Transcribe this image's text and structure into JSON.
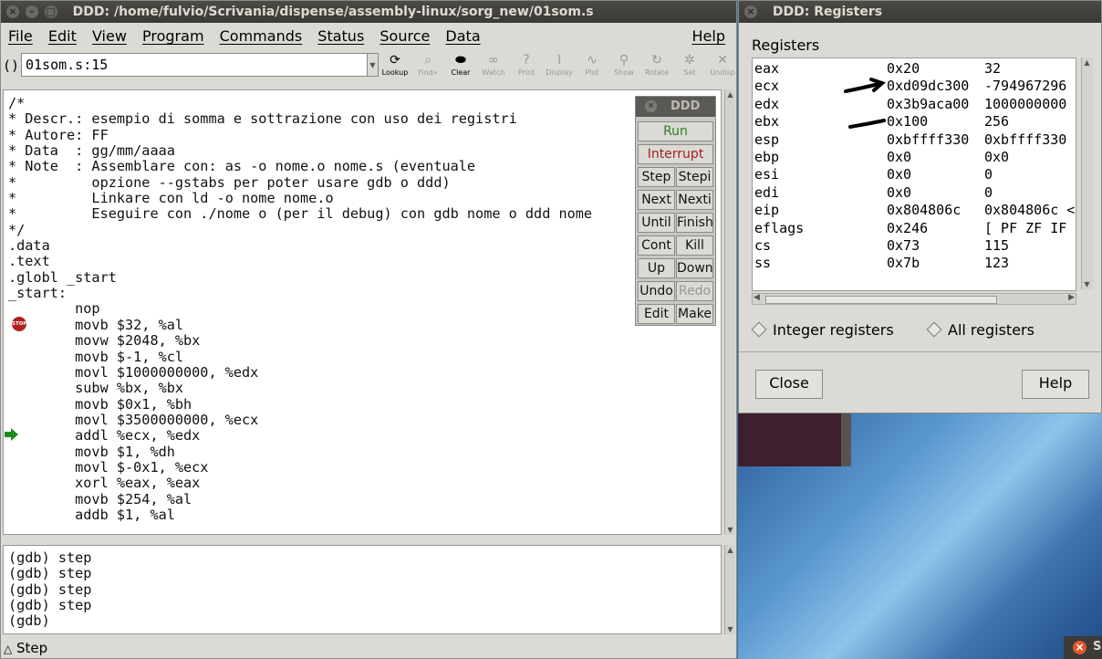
{
  "main_window": {
    "title": "DDD: /home/fulvio/Scrivania/dispense/assembly-linux/sorg_new/01som.s",
    "menu": [
      "File",
      "Edit",
      "View",
      "Program",
      "Commands",
      "Status",
      "Source",
      "Data"
    ],
    "help": "Help",
    "arg_label": "():",
    "arg_value": "01som.s:15",
    "tools": [
      {
        "label": "Lookup",
        "icon": "lookup-icon",
        "active": true
      },
      {
        "label": "Find»",
        "icon": "find-icon",
        "active": false
      },
      {
        "label": "Clear",
        "icon": "clear-icon",
        "active": true
      },
      {
        "label": "Watch",
        "icon": "watch-icon",
        "active": false
      },
      {
        "label": "Print",
        "icon": "print-icon",
        "active": false
      },
      {
        "label": "Display",
        "icon": "display-icon",
        "active": false
      },
      {
        "label": "Plot",
        "icon": "plot-icon",
        "active": false
      },
      {
        "label": "Show",
        "icon": "show-icon",
        "active": false
      },
      {
        "label": "Rotate",
        "icon": "rotate-icon",
        "active": false
      },
      {
        "label": "Set",
        "icon": "set-icon",
        "active": false
      },
      {
        "label": "Undisp",
        "icon": "undisp-icon",
        "active": false
      }
    ],
    "source_lines": [
      "/*",
      "* Descr.: esempio di somma e sottrazione con uso dei registri",
      "* Autore: FF",
      "* Data  : gg/mm/aaaa",
      "* Note  : Assemblare con: as -o nome.o nome.s (eventuale",
      "*         opzione --gstabs per poter usare gdb o ddd)",
      "*         Linkare con ld -o nome nome.o",
      "*         Eseguire con ./nome o (per il debug) con gdb nome o ddd nome",
      "*/",
      ".data",
      ".text",
      ".globl _start",
      "_start:",
      "        nop",
      "        movb $32, %al",
      "        movw $2048, %bx",
      "        movb $-1, %cl",
      "        movl $1000000000, %edx",
      "        subw %bx, %bx",
      "        movb $0x1, %bh",
      "        movl $3500000000, %ecx",
      "        addl %ecx, %edx",
      "        movb $1, %dh",
      "        movl $-0x1, %ecx",
      "        xorl %eax, %eax",
      "        movb $254, %al",
      "        addb $1, %al"
    ],
    "breakpoint_label": "STOP",
    "console_lines": [
      "(gdb) step",
      "(gdb) step",
      "(gdb) step",
      "(gdb) step",
      "(gdb)"
    ],
    "status": "Step"
  },
  "command_panel": {
    "title": "DDD",
    "run": "Run",
    "interrupt": "Interrupt",
    "buttons": [
      "Step",
      "Stepi",
      "Next",
      "Nexti",
      "Until",
      "Finish",
      "Cont",
      "Kill",
      "Up",
      "Down",
      "Undo",
      "Redo",
      "Edit",
      "Make"
    ],
    "disabled": [
      "Redo"
    ],
    "colors": {
      "run": "#2e7d1f",
      "interrupt": "#a12020"
    }
  },
  "registers_window": {
    "title": "DDD: Registers",
    "heading": "Registers",
    "rows": [
      {
        "name": "eax",
        "hex": "0x20",
        "value": "32"
      },
      {
        "name": "ecx",
        "hex": "0xd09dc300",
        "value": "-794967296"
      },
      {
        "name": "edx",
        "hex": "0x3b9aca00",
        "value": "1000000000"
      },
      {
        "name": "ebx",
        "hex": "0x100",
        "value": "256"
      },
      {
        "name": "esp",
        "hex": "0xbffff330",
        "value": "0xbffff330"
      },
      {
        "name": "ebp",
        "hex": "0x0",
        "value": "0x0"
      },
      {
        "name": "esi",
        "hex": "0x0",
        "value": "0"
      },
      {
        "name": "edi",
        "hex": "0x0",
        "value": "0"
      },
      {
        "name": "eip",
        "hex": "0x804806c",
        "value": "0x804806c <"
      },
      {
        "name": "eflags",
        "hex": "0x246",
        "value": "[ PF ZF IF"
      },
      {
        "name": "cs",
        "hex": "0x73",
        "value": "115"
      },
      {
        "name": "ss",
        "hex": "0x7b",
        "value": "123"
      }
    ],
    "radio_integer": "Integer registers",
    "radio_all": "All registers",
    "close": "Close",
    "help": "Help"
  },
  "desktop_partial_window": {
    "close_glyph": "×",
    "title_fragment": "S"
  }
}
